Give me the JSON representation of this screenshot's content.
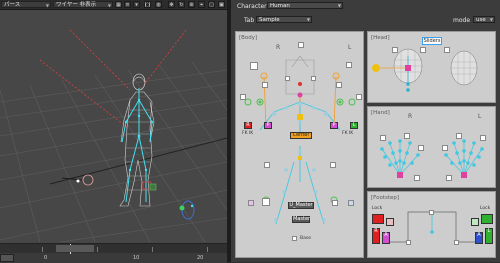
{
  "viewport": {
    "view_mode": "パース",
    "display_mode": "ワイヤー",
    "hide_label": "非表示",
    "timeline_ticks": [
      "0",
      "10",
      "20"
    ]
  },
  "panel": {
    "character_label": "Character",
    "character_value": "Human",
    "tab_label": "Tab",
    "tab_value": "Sample",
    "mode_label": "mode",
    "mode_value": "use",
    "sections": {
      "body": {
        "title": "[Body]",
        "left": "R",
        "right": "L"
      },
      "head": {
        "title": "[Head]",
        "sliders_button": "Sliders"
      },
      "hand": {
        "title": "[Hand]",
        "left": "R",
        "right": "L"
      },
      "footstep": {
        "title": "[Footstep]",
        "lock_left": "Lock",
        "lock_right": "Lock"
      }
    },
    "body_buttons": {
      "center": "Center",
      "u_master": "U_Master",
      "master": "Master",
      "r_marker": "R",
      "l_marker": "L",
      "p_left": "P",
      "p_right": "P",
      "fk_ik_left": "FK IK",
      "fk_ik_right": "FK IK",
      "base_label": "Base"
    },
    "footstep_buttons": {
      "a_left": "A",
      "a_right": "A",
      "r_left": "R",
      "l_right": "L"
    }
  }
}
